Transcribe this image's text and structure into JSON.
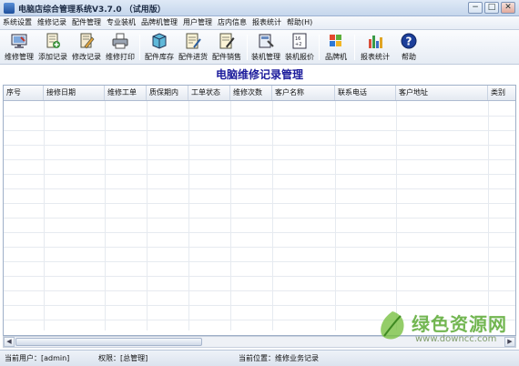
{
  "window": {
    "title": "电脑店综合管理系统V3.7.0 （试用版）",
    "controls": [
      "−",
      "□",
      "✕"
    ]
  },
  "menu": {
    "items": [
      "系统设置",
      "维修记录",
      "配件管理",
      "专业装机",
      "品牌机管理",
      "用户管理",
      "店内信息",
      "报表统计",
      "帮助(H)"
    ]
  },
  "toolbar": {
    "buttons": [
      {
        "label": "维修管理",
        "icon": "monitor-repair-icon"
      },
      {
        "label": "添加记录",
        "icon": "add-record-icon"
      },
      {
        "label": "修改记录",
        "icon": "edit-record-icon"
      },
      {
        "label": "维修打印",
        "icon": "printer-icon"
      },
      {
        "label": "配件库存",
        "icon": "parts-stock-icon"
      },
      {
        "label": "配件进货",
        "icon": "parts-purchase-icon"
      },
      {
        "label": "配件销售",
        "icon": "parts-sales-icon"
      },
      {
        "label": "装机管理",
        "icon": "assembly-manage-icon"
      },
      {
        "label": "装机报价",
        "icon": "assembly-quote-icon"
      },
      {
        "label": "品牌机",
        "icon": "brand-pc-icon"
      },
      {
        "label": "报表统计",
        "icon": "bar-chart-icon"
      },
      {
        "label": "帮助",
        "icon": "help-icon"
      }
    ]
  },
  "main": {
    "title": "电脑维修记录管理"
  },
  "table": {
    "columns": [
      "序号",
      "接修日期",
      "维修工单",
      "质保期内",
      "工单状态",
      "维修次数",
      "客户名称",
      "联系电话",
      "客户地址",
      "类别"
    ],
    "rows": []
  },
  "status": {
    "user": "当前用户：[admin]",
    "permission": "权限：[总管理]",
    "location": "当前位置：维修业务记录"
  },
  "watermark": {
    "text": "绿色资源网",
    "url": "www.downcc.com"
  },
  "colors": {
    "title_blue": "#1c1c9c",
    "watermark_green": "#5aaa33"
  }
}
